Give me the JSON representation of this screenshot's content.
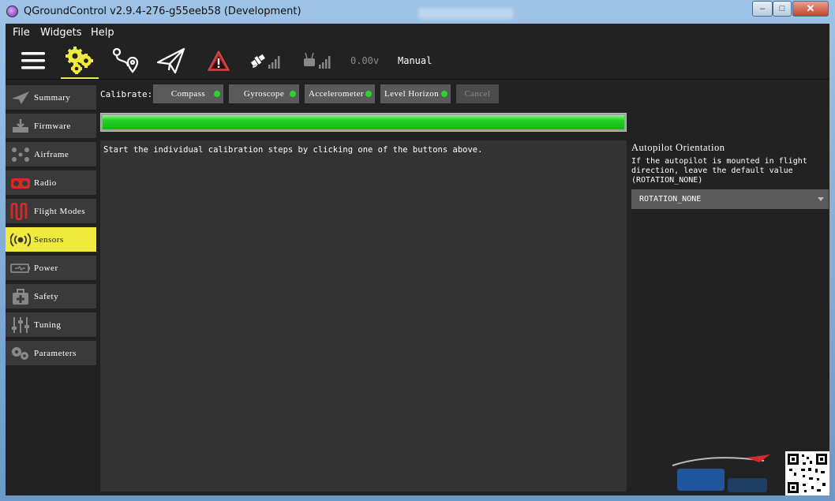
{
  "window": {
    "title": "QGroundControl v2.9.4-276-g55eeb58 (Development)",
    "controls": {
      "minimize": "–",
      "maximize": "□",
      "close": "✕"
    }
  },
  "menu": {
    "items": [
      "File",
      "Widgets",
      "Help"
    ]
  },
  "toolbar": {
    "icons": [
      "menu-icon",
      "gears-icon",
      "plan-icon",
      "fly-icon",
      "warning-icon",
      "gps-icon",
      "rc-signal-icon"
    ],
    "battery": "0.00v",
    "mode": "Manual",
    "active": "gears-icon",
    "accent_color": "#e8e85a"
  },
  "sidebar": {
    "items": [
      {
        "label": "Summary",
        "icon": "plane-icon",
        "active": false
      },
      {
        "label": "Firmware",
        "icon": "firmware-icon",
        "active": false
      },
      {
        "label": "Airframe",
        "icon": "airframe-icon",
        "active": false
      },
      {
        "label": "Radio",
        "icon": "radio-icon",
        "active": false
      },
      {
        "label": "Flight Modes",
        "icon": "flight-modes-icon",
        "active": false
      },
      {
        "label": "Sensors",
        "icon": "sensors-icon",
        "active": true
      },
      {
        "label": "Power",
        "icon": "power-icon",
        "active": false
      },
      {
        "label": "Safety",
        "icon": "safety-icon",
        "active": false
      },
      {
        "label": "Tuning",
        "icon": "tuning-icon",
        "active": false
      },
      {
        "label": "Parameters",
        "icon": "parameters-icon",
        "active": false
      }
    ],
    "active_color": "#f0ea3c"
  },
  "sensors": {
    "calibrate_label": "Calibrate:",
    "buttons": [
      {
        "label": "Compass",
        "status": "ok"
      },
      {
        "label": "Gyroscope",
        "status": "ok"
      },
      {
        "label": "Accelerometer",
        "status": "ok"
      },
      {
        "label": "Level Horizon",
        "status": "ok"
      },
      {
        "label": "Cancel",
        "status": "disabled"
      }
    ],
    "progress": 1.0,
    "status_color": "#27d427",
    "instruction": "Start the individual calibration steps by clicking one of the buttons above."
  },
  "orientation": {
    "title": "Autopilot Orientation",
    "description": "If the autopilot is mounted in flight direction, leave the default value (ROTATION_NONE)",
    "selected": "ROTATION_NONE"
  }
}
